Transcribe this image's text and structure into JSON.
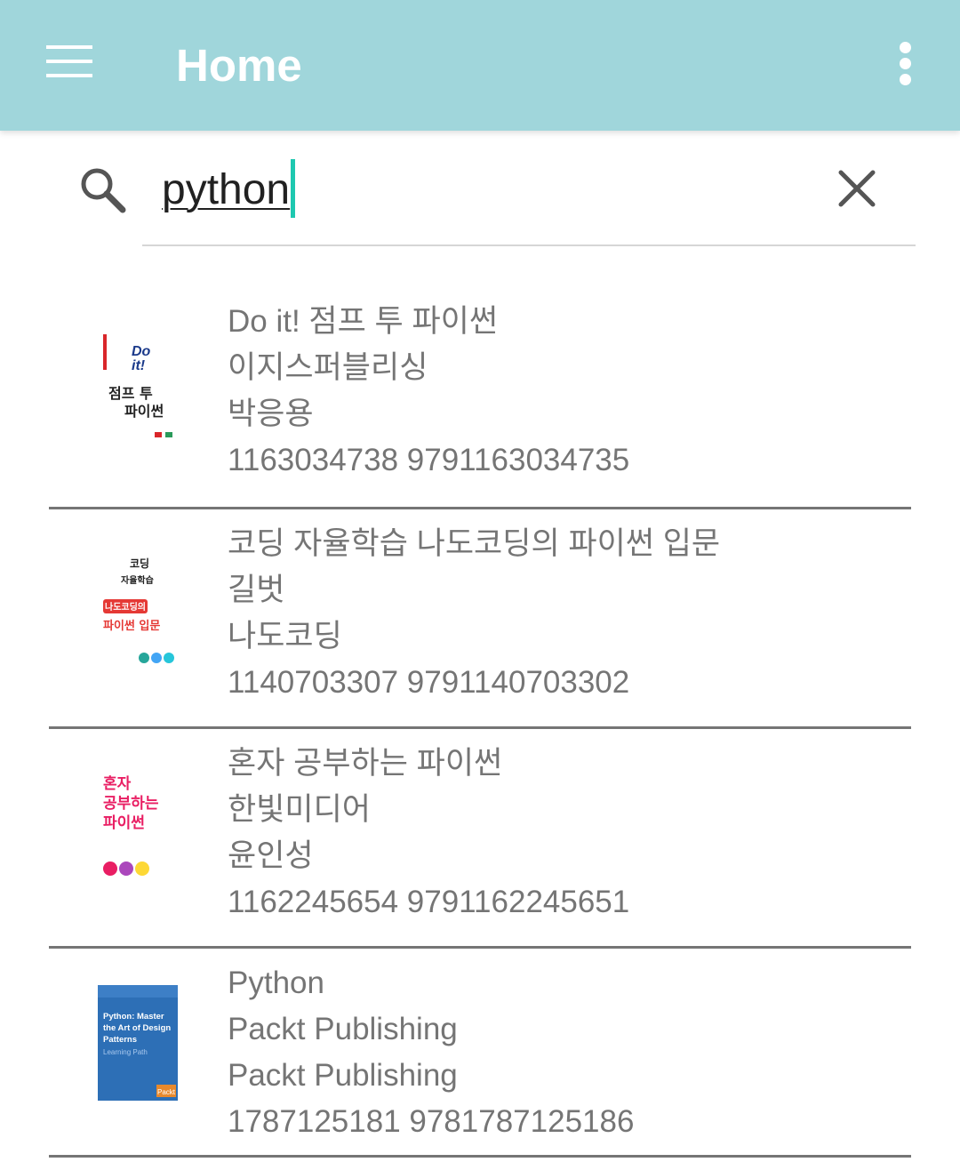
{
  "appbar": {
    "title": "Home",
    "menu_icon": "hamburger-menu-icon",
    "overflow_icon": "more-vert-icon",
    "background": "#a0d6db"
  },
  "search": {
    "query": "python",
    "search_icon": "search-icon",
    "clear_icon": "close-icon",
    "caret_color": "#1ec8b0"
  },
  "results": [
    {
      "title": "Do it! 점프 투 파이썬",
      "publisher": "이지스퍼블리싱",
      "author": "박응용",
      "isbn": "1163034738 9791163034735",
      "cover_lines": [
        "Do",
        "it!",
        "점프 투",
        "파이썬"
      ]
    },
    {
      "title": "코딩 자율학습 나도코딩의 파이썬 입문",
      "publisher": "길벗",
      "author": "나도코딩",
      "isbn": "1140703307 9791140703302",
      "cover_lines": [
        "코딩",
        "자율학습",
        "나도코딩의",
        "파이썬 입문"
      ]
    },
    {
      "title": "혼자 공부하는 파이썬",
      "publisher": "한빛미디어",
      "author": "윤인성",
      "isbn": "1162245654 9791162245651",
      "cover_lines": [
        "혼자",
        "공부하는",
        "파이썬"
      ]
    },
    {
      "title": "Python",
      "publisher": "Packt Publishing",
      "author": "Packt Publishing",
      "isbn": "1787125181 9781787125186",
      "cover_lines": [
        "Python: Master",
        "the Art of Design",
        "Patterns",
        "Learning Path",
        "Packt"
      ]
    }
  ]
}
